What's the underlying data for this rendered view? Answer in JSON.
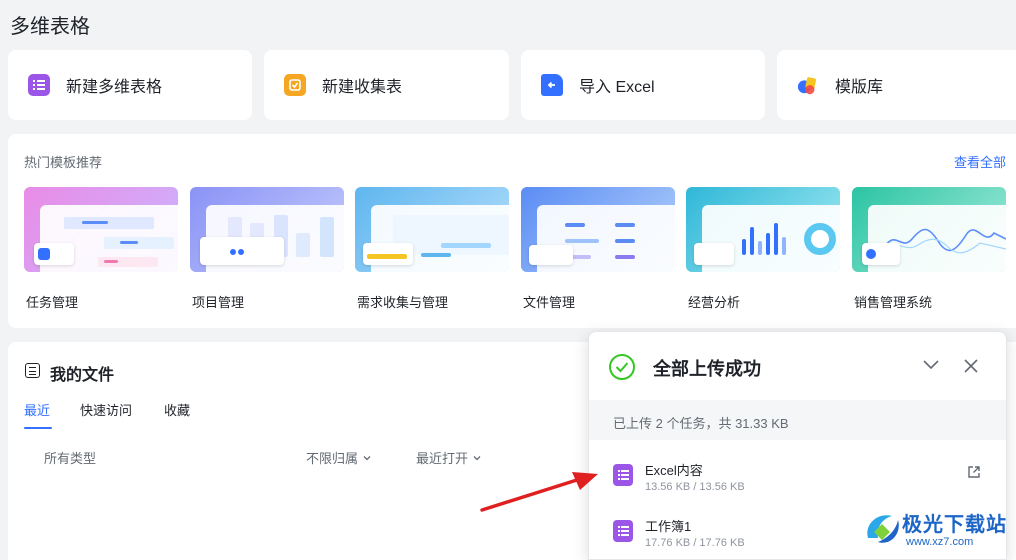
{
  "page_title": "多维表格",
  "actions": [
    {
      "label": "新建多维表格",
      "icon": "table-icon",
      "color": "#9b56e8"
    },
    {
      "label": "新建收集表",
      "icon": "form-icon",
      "color": "#f5a623"
    },
    {
      "label": "导入 Excel",
      "icon": "import-icon",
      "color": "#3370ff"
    },
    {
      "label": "模版库",
      "icon": "template-library-icon",
      "color": "#f5a623"
    }
  ],
  "templates": {
    "header": "热门模板推荐",
    "view_all": "查看全部",
    "items": [
      {
        "name": "任务管理",
        "gradient": [
          "#e98be6",
          "#c9b8ff"
        ]
      },
      {
        "name": "项目管理",
        "gradient": [
          "#8a93f5",
          "#c6cdfd"
        ]
      },
      {
        "name": "需求收集与管理",
        "gradient": [
          "#5fb6ef",
          "#b7e0fb"
        ]
      },
      {
        "name": "文件管理",
        "gradient": [
          "#5a8cf4",
          "#b7d3fb"
        ]
      },
      {
        "name": "经营分析",
        "gradient": [
          "#2fb7d8",
          "#a6ecf2"
        ]
      },
      {
        "name": "销售管理系统",
        "gradient": [
          "#2bc4a3",
          "#a6ecdc"
        ]
      }
    ]
  },
  "files": {
    "title": "我的文件",
    "tabs": [
      "最近",
      "快速访问",
      "收藏"
    ],
    "active_tab": "最近",
    "filters": {
      "type": "所有类型",
      "owner": "不限归属",
      "sort": "最近打开"
    }
  },
  "upload_popup": {
    "title": "全部上传成功",
    "summary": "已上传 2 个任务，共 31.33 KB",
    "items": [
      {
        "name": "Excel内容",
        "size": "13.56 KB / 13.56 KB"
      },
      {
        "name": "工作簿1",
        "size": "17.76 KB / 17.76 KB"
      }
    ]
  },
  "watermark": {
    "main": "极光下载站",
    "sub": "www.xz7.com"
  }
}
